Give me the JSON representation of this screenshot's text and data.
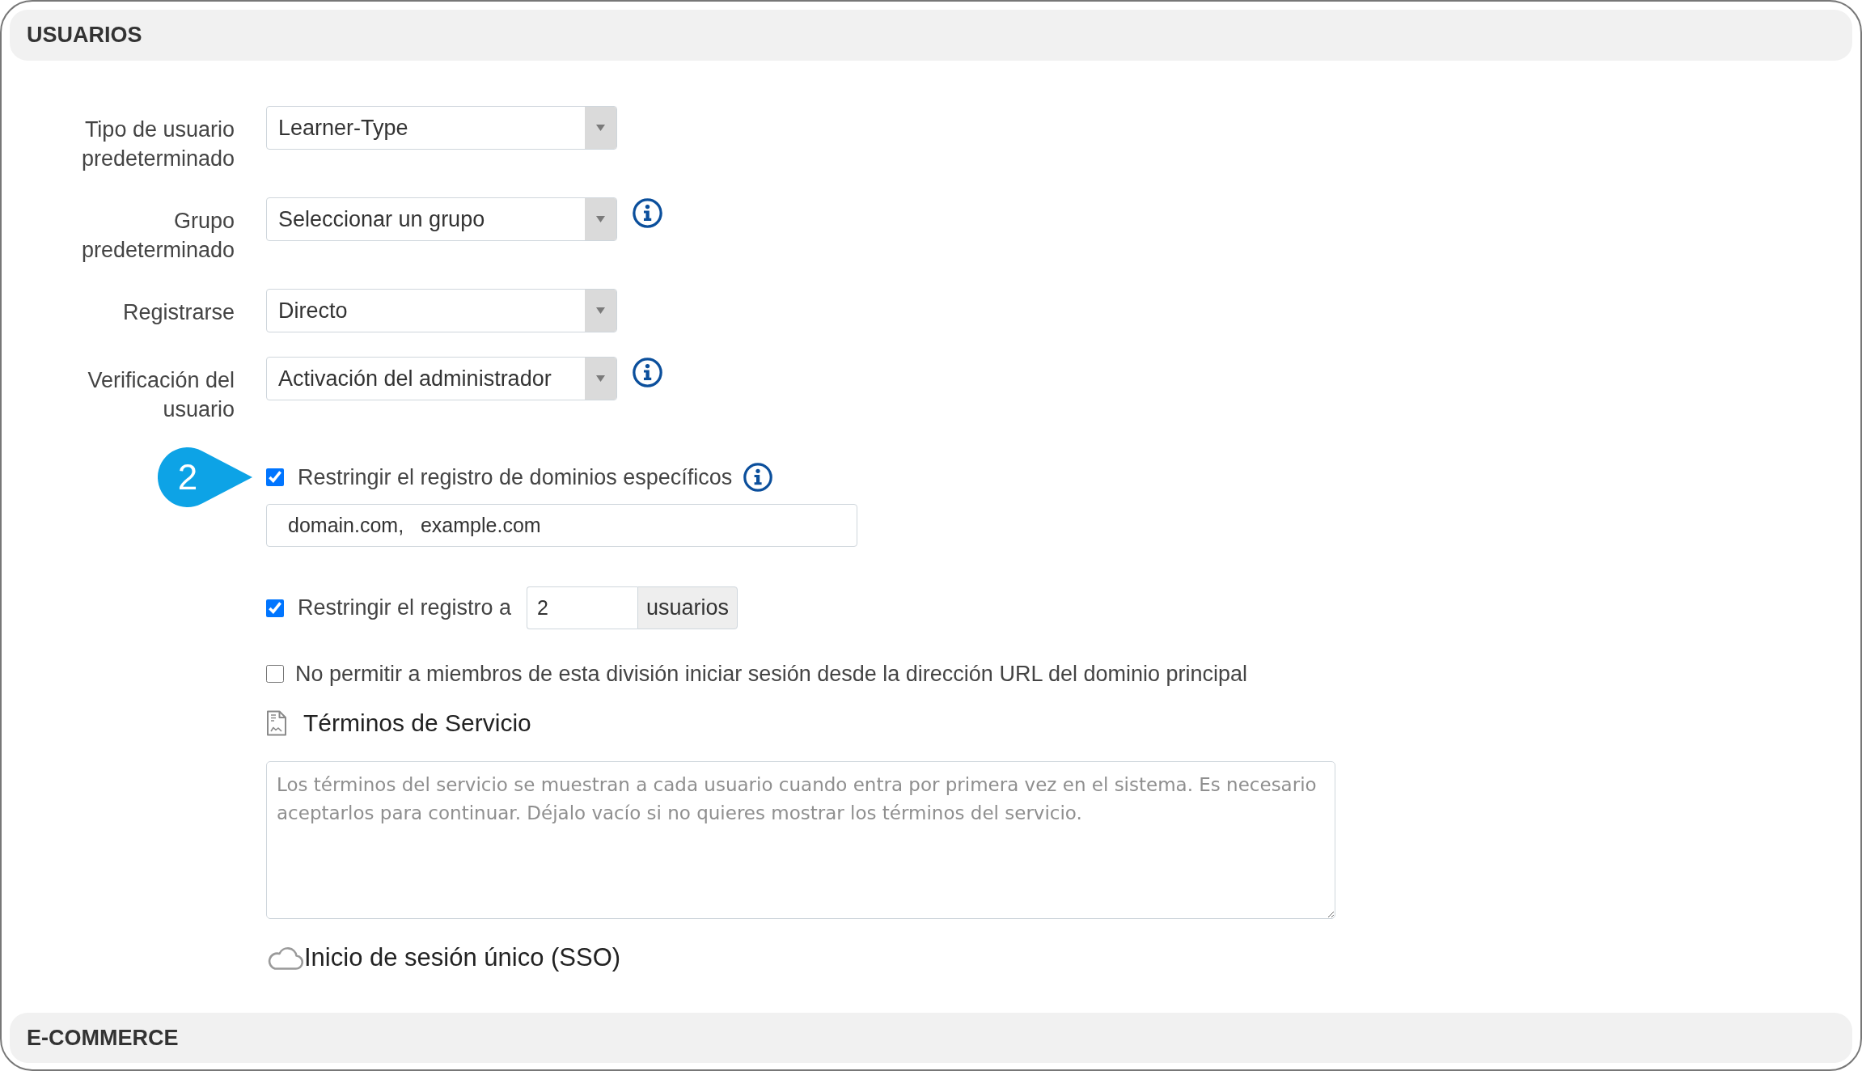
{
  "users_section": {
    "title": "USUARIOS",
    "fields": [
      {
        "label": "Tipo de usuario predeterminado",
        "value": "Learner-Type",
        "info": false
      },
      {
        "label": "Grupo predeterminado",
        "value": "Seleccionar un grupo",
        "info": true
      },
      {
        "label": "Registrarse",
        "value": "Directo",
        "info": false
      },
      {
        "label": "Verificación del usuario",
        "value": "Activación del administrador",
        "info": true
      }
    ],
    "step_marker": "2",
    "restrict_domains": {
      "label": "Restringir el registro de dominios específicos",
      "checked": true,
      "info": true,
      "value": "domain.com,   example.com"
    },
    "restrict_count": {
      "label": "Restringir el registro a",
      "checked": true,
      "value": "2",
      "unit": "usuarios"
    },
    "block_main_domain_login": {
      "label": "No permitir a miembros de esta división iniciar sesión desde la dirección URL del dominio principal",
      "checked": false
    },
    "terms_of_service": {
      "title": "Términos de Servicio",
      "placeholder": "Los términos del servicio se muestran a cada usuario cuando entra por primera vez en el sistema. Es necesario aceptarlos para continuar. Déjalo vacío si no quieres mostrar los términos del servicio."
    },
    "sso": {
      "title": "Inicio de sesión único (SSO)"
    }
  },
  "ecommerce_section": {
    "title": "E-COMMERCE"
  }
}
